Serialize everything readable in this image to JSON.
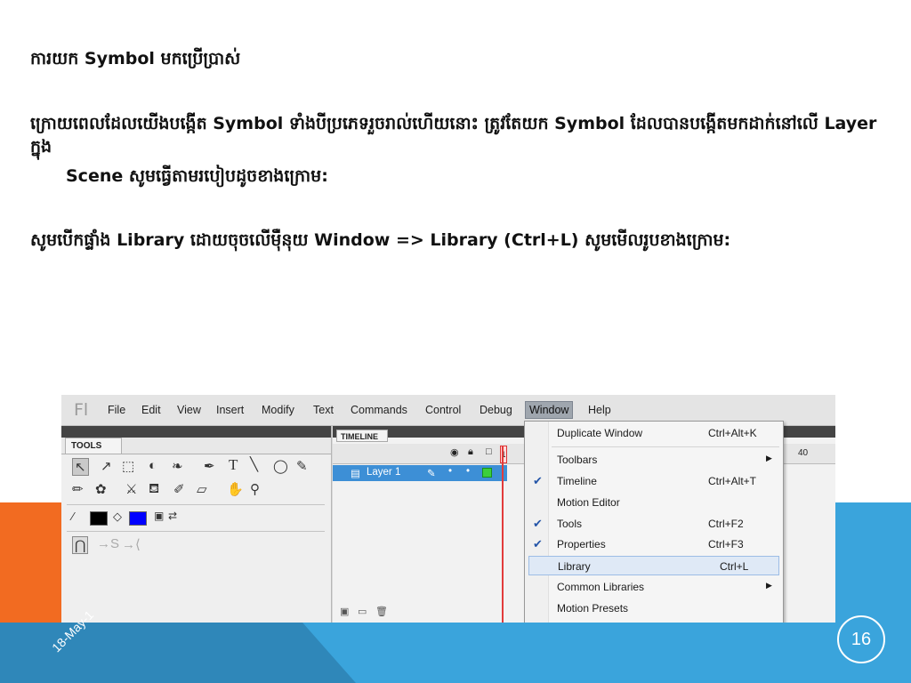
{
  "text": {
    "heading": "ការយក Symbol មកប្រើប្រាស់",
    "para1": "ក្រោយពេលដែលយើងបង្កើត Symbol ទាំងបីប្រភេទរួចរាល់ហើយនោះ ត្រូវតែយក Symbol ដែលបានបង្កើតមកដាក់នៅលើ Layer ក្នុង",
    "para1_cont": "Scene សូមធ្វើតាមរបៀបដូចខាងក្រោម:",
    "para2": "សូមបើកផ្ទាំង Library ដោយចុចលើម៉ឺនុយ Window => Library (Ctrl+L) សូមមើលរូបខាងក្រោម:"
  },
  "footer": {
    "date": "18-May-1",
    "page_number": "16"
  },
  "screenshot": {
    "logo": "Fl",
    "menu": [
      "File",
      "Edit",
      "View",
      "Insert",
      "Modify",
      "Text",
      "Commands",
      "Control",
      "Debug",
      "Window",
      "Help"
    ],
    "active_menu": "Window",
    "tools_tab": "TOOLS",
    "timeline_tab": "TIMELINE",
    "layer_name": "Layer 1",
    "frame_number": "1",
    "ruler_label": "40",
    "dropdown": [
      {
        "label": "Duplicate Window",
        "shortcut": "Ctrl+Alt+K",
        "checked": false,
        "submenu": false
      },
      {
        "label": "Toolbars",
        "shortcut": "",
        "checked": false,
        "submenu": true
      },
      {
        "label": "Timeline",
        "shortcut": "Ctrl+Alt+T",
        "checked": true,
        "submenu": false
      },
      {
        "label": "Motion Editor",
        "shortcut": "",
        "checked": false,
        "submenu": false
      },
      {
        "label": "Tools",
        "shortcut": "Ctrl+F2",
        "checked": true,
        "submenu": false
      },
      {
        "label": "Properties",
        "shortcut": "Ctrl+F3",
        "checked": true,
        "submenu": false
      },
      {
        "label": "Library",
        "shortcut": "Ctrl+L",
        "checked": false,
        "submenu": false,
        "highlighted": true
      },
      {
        "label": "Common Libraries",
        "shortcut": "",
        "checked": false,
        "submenu": true
      },
      {
        "label": "Motion Presets",
        "shortcut": "",
        "checked": false,
        "submenu": false
      }
    ]
  },
  "colors": {
    "orange": "#f26b21",
    "blue": "#3aa4dc",
    "layer_highlight": "#3d8fd6"
  }
}
